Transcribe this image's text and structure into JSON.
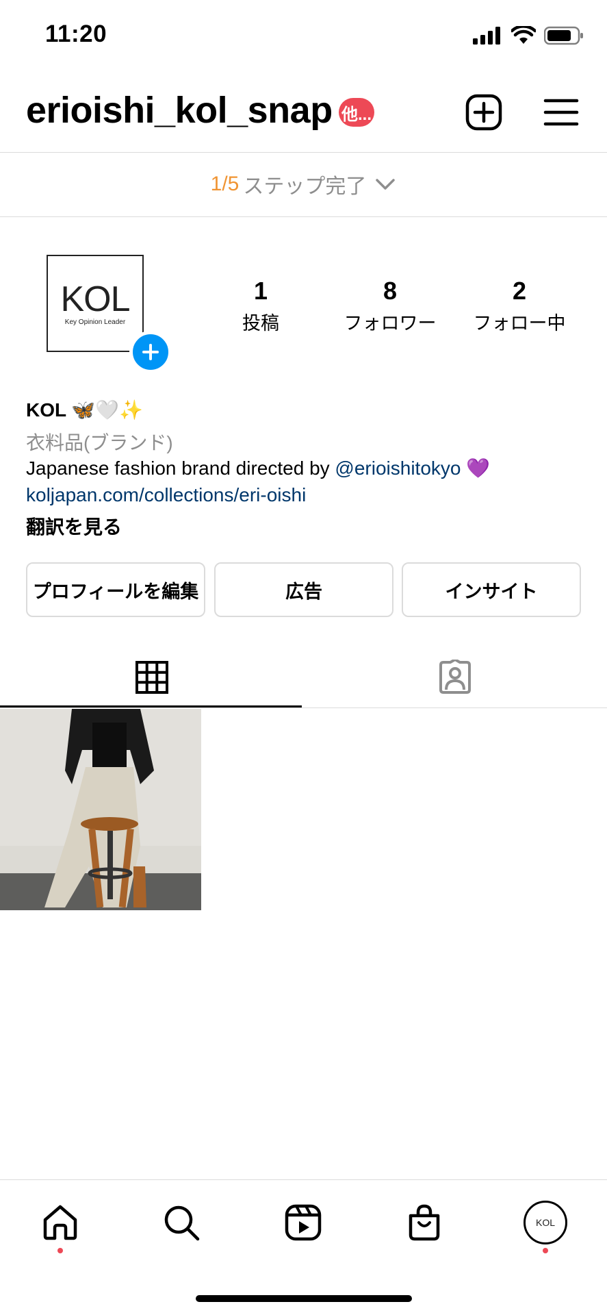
{
  "status_bar": {
    "time": "11:20"
  },
  "header": {
    "username": "erioishi_kol_snap",
    "badge": "他..."
  },
  "steps": {
    "count": "1/5",
    "label": "ステップ完了"
  },
  "profile": {
    "avatar_logo": "KOL",
    "avatar_tagline": "Key Opinion Leader",
    "stats": [
      {
        "value": "1",
        "label": "投稿"
      },
      {
        "value": "8",
        "label": "フォロワー"
      },
      {
        "value": "2",
        "label": "フォロー中"
      }
    ]
  },
  "bio": {
    "name": "KOL 🦋🤍✨",
    "category": "衣料品(ブランド)",
    "text_prefix": "Japanese fashion brand directed by ",
    "mention": "@erioishitokyo",
    "text_suffix": " 💜",
    "link": "koljapan.com/collections/eri-oishi",
    "translate": "翻訳を見る"
  },
  "buttons": {
    "edit": "プロフィールを編集",
    "ads": "広告",
    "insights": "インサイト"
  },
  "colors": {
    "accent_blue": "#0095f6",
    "badge_red": "#ed4956",
    "link_blue": "#00376b",
    "step_orange": "#f09433"
  }
}
